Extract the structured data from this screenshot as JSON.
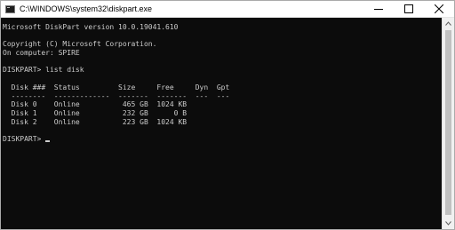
{
  "window": {
    "title": "C:\\WINDOWS\\system32\\diskpart.exe",
    "controls": {
      "minimize": "minimize",
      "maximize": "maximize",
      "close": "close"
    }
  },
  "console": {
    "lines": [
      "Microsoft DiskPart version 10.0.19041.610",
      "",
      "Copyright (C) Microsoft Corporation.",
      "On computer: SPIRE",
      "",
      "DISKPART> list disk",
      "",
      "  Disk ###  Status         Size     Free     Dyn  Gpt",
      "  --------  -------------  -------  -------  ---  ---",
      "  Disk 0    Online          465 GB  1024 KB",
      "  Disk 1    Online          232 GB      0 B",
      "  Disk 2    Online          223 GB  1024 KB",
      "",
      "DISKPART> "
    ]
  },
  "colors": {
    "console_bg": "#0c0c0c",
    "console_text": "#cccccc",
    "titlebar_bg": "#ffffff"
  }
}
